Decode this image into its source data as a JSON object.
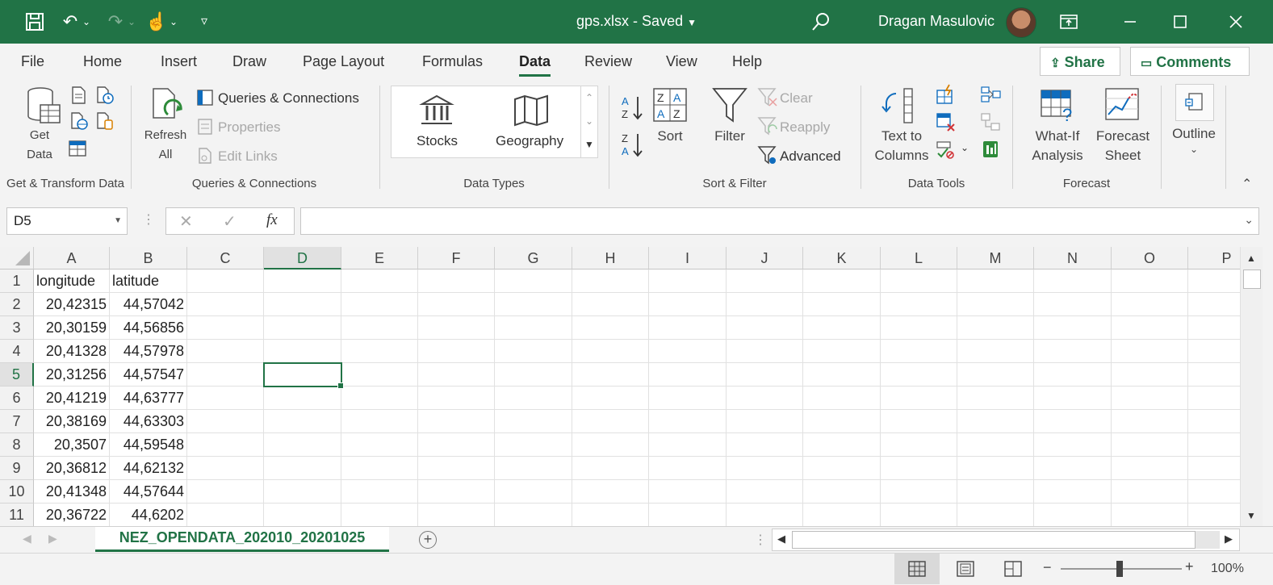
{
  "titlebar": {
    "filename": "gps.xlsx",
    "separator": "-",
    "status": "Saved",
    "user": "Dragan Masulovic"
  },
  "menu": {
    "tabs": [
      "File",
      "Home",
      "Insert",
      "Draw",
      "Page Layout",
      "Formulas",
      "Data",
      "Review",
      "View",
      "Help"
    ],
    "active_tab": "Data",
    "share_label": "Share",
    "comments_label": "Comments"
  },
  "ribbon": {
    "get_transform": {
      "get_data_1": "Get",
      "get_data_2": "Data",
      "group": "Get & Transform Data"
    },
    "queries": {
      "refresh_1": "Refresh",
      "refresh_2": "All",
      "queries_connections": "Queries & Connections",
      "properties": "Properties",
      "edit_links": "Edit Links",
      "group": "Queries & Connections"
    },
    "data_types": {
      "stocks": "Stocks",
      "geography": "Geography",
      "group": "Data Types"
    },
    "sort_filter": {
      "sort": "Sort",
      "filter": "Filter",
      "clear": "Clear",
      "reapply": "Reapply",
      "advanced": "Advanced",
      "group": "Sort & Filter"
    },
    "data_tools": {
      "text_to_columns_1": "Text to",
      "text_to_columns_2": "Columns",
      "group": "Data Tools"
    },
    "forecast": {
      "what_if_1": "What-If",
      "what_if_2": "Analysis",
      "forecast_sheet_1": "Forecast",
      "forecast_sheet_2": "Sheet",
      "group": "Forecast"
    },
    "outline": {
      "label": "Outline"
    }
  },
  "formula_bar": {
    "name_box": "D5",
    "formula": "",
    "fx": "fx"
  },
  "sheet": {
    "columns": [
      "A",
      "B",
      "C",
      "D",
      "E",
      "F",
      "G",
      "H",
      "I",
      "J",
      "K",
      "L",
      "M",
      "N",
      "O",
      "P"
    ],
    "selected_column": "D",
    "selected_row": 5,
    "rows": [
      {
        "n": "1",
        "a": "longitude",
        "b": "latitude"
      },
      {
        "n": "2",
        "a": "20,42315",
        "b": "44,57042"
      },
      {
        "n": "3",
        "a": "20,30159",
        "b": "44,56856"
      },
      {
        "n": "4",
        "a": "20,41328",
        "b": "44,57978"
      },
      {
        "n": "5",
        "a": "20,31256",
        "b": "44,57547"
      },
      {
        "n": "6",
        "a": "20,41219",
        "b": "44,63777"
      },
      {
        "n": "7",
        "a": "20,38169",
        "b": "44,63303"
      },
      {
        "n": "8",
        "a": "20,3507",
        "b": "44,59548"
      },
      {
        "n": "9",
        "a": "20,36812",
        "b": "44,62132"
      },
      {
        "n": "10",
        "a": "20,41348",
        "b": "44,57644"
      },
      {
        "n": "11",
        "a": "20,36722",
        "b": "44,6202"
      }
    ]
  },
  "sheet_tabs": {
    "active": "NEZ_OPENDATA_202010_20201025"
  },
  "statusbar": {
    "zoom": "100%"
  },
  "colors": {
    "accent": "#217346"
  }
}
